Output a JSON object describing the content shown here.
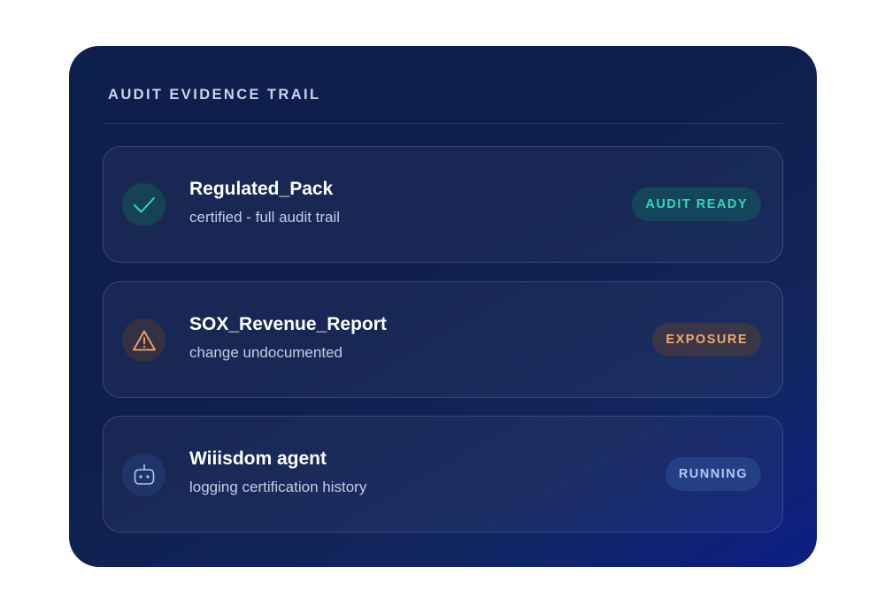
{
  "panel": {
    "title": "AUDIT EVIDENCE TRAIL"
  },
  "rows": [
    {
      "name": "Regulated_Pack",
      "subtitle": "certified - full audit trail",
      "icon": "check-icon",
      "badge": "AUDIT READY",
      "badge_color": "#2ed9bd"
    },
    {
      "name": "SOX_Revenue_Report",
      "subtitle": "change undocumented",
      "icon": "warning-icon",
      "badge": "EXPOSURE",
      "badge_color": "#f2a968"
    },
    {
      "name": "Wiiisdom agent",
      "subtitle": "logging certification history",
      "icon": "robot-icon",
      "badge": "RUNNING",
      "badge_color": "#b5c6f2"
    }
  ],
  "colors": {
    "panel_background": "#0f1f4d",
    "accent_teal": "#2ed9bd",
    "accent_orange": "#f2a968",
    "accent_blue": "#b5c6f2"
  }
}
